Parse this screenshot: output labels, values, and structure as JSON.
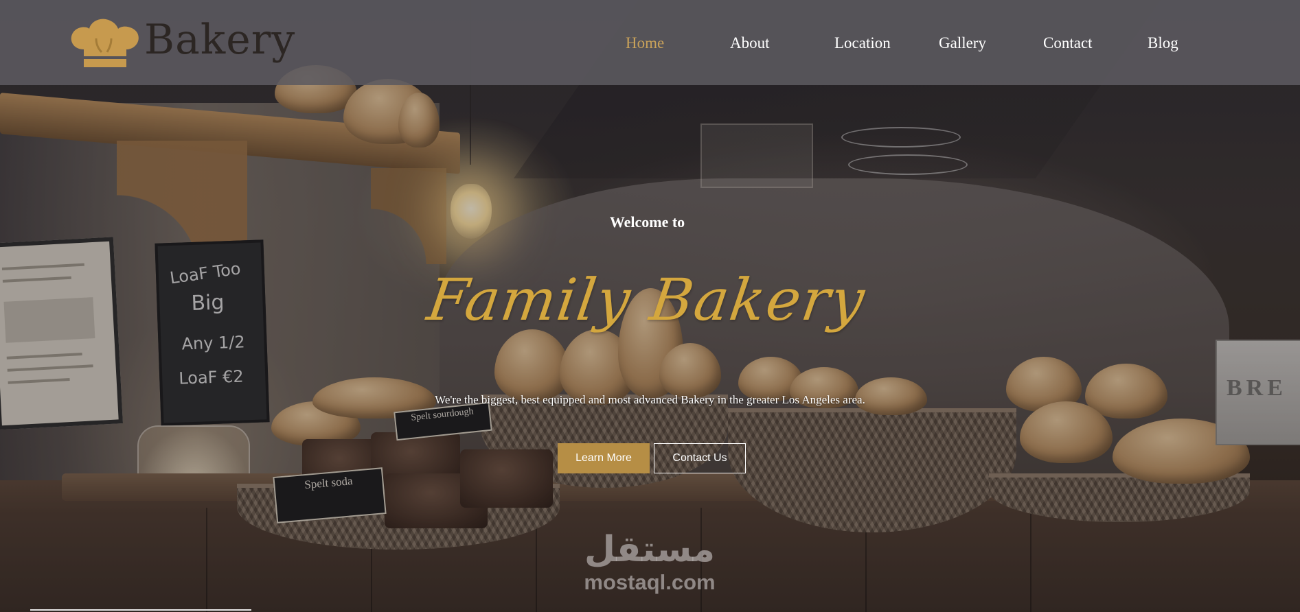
{
  "brand": {
    "name": "Bakery",
    "logo_icon": "chef-hat-icon"
  },
  "nav": {
    "items": [
      {
        "label": "Home",
        "active": true
      },
      {
        "label": "About",
        "active": false
      },
      {
        "label": "Location",
        "active": false
      },
      {
        "label": "Gallery",
        "active": false
      },
      {
        "label": "Contact",
        "active": false
      },
      {
        "label": "Blog",
        "active": false
      }
    ]
  },
  "hero": {
    "welcome": "Welcome to",
    "title": "Family Bakery",
    "subtitle": "We're the biggest, best equipped and most advanced Bakery in the greater Los Angeles area.",
    "primary_button": "Learn More",
    "secondary_button": "Contact Us"
  },
  "scene": {
    "chalkboard": [
      "LoaF Too",
      "Big",
      "Any 1/2",
      "LoaF €2"
    ],
    "cards": [
      "Spelt soda",
      "Spelt sourdough"
    ],
    "bread_box": "BRE"
  },
  "watermark": {
    "arabic": "مستقل",
    "latin": "mostaql.com"
  },
  "colors": {
    "accent": "#c8a15a",
    "title_gold": "#d4a73e",
    "button_gold": "#b68e45",
    "navbar": "#5c5a60"
  }
}
